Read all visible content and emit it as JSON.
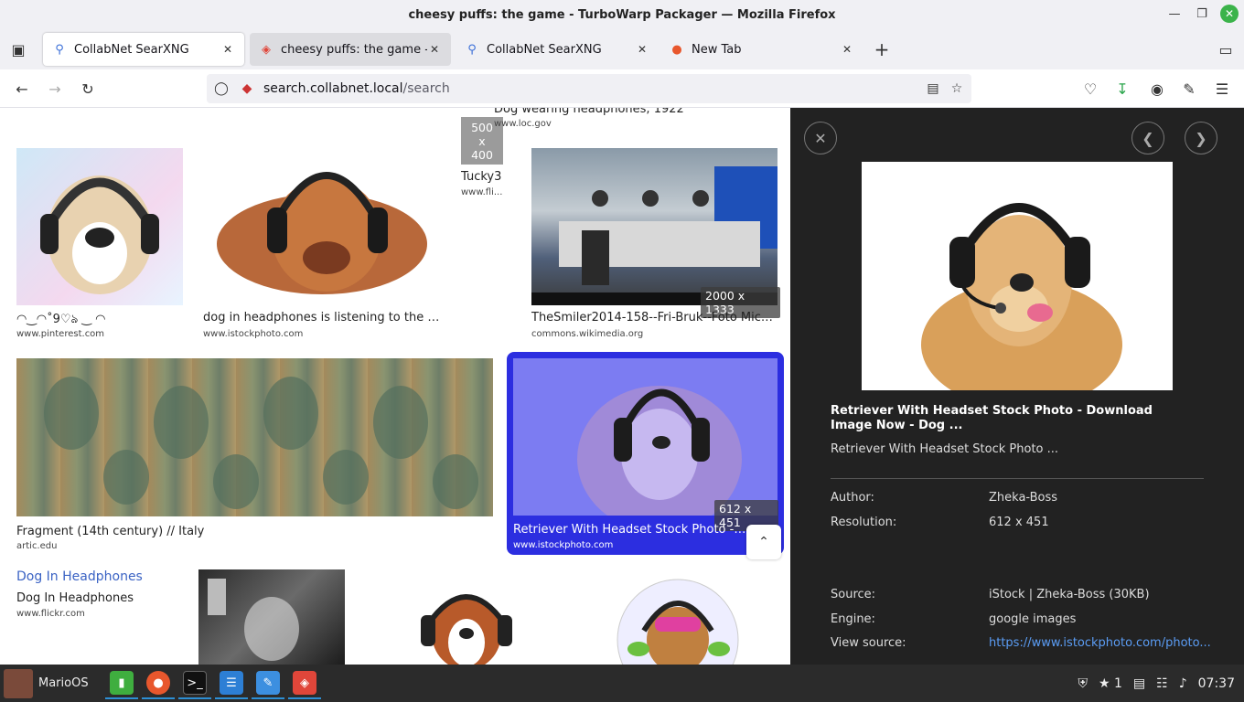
{
  "window": {
    "title": "cheesy puffs: the game - TurboWarp Packager — Mozilla Firefox"
  },
  "tabs": [
    {
      "label": "CollabNet SearXNG",
      "favicon": "search-icon"
    },
    {
      "label": "cheesy puffs: the game - TurboWarp Packager",
      "favicon": "turbowarp-icon"
    },
    {
      "label": "CollabNet SearXNG",
      "favicon": "search-icon"
    },
    {
      "label": "New Tab",
      "favicon": "firefox-icon"
    }
  ],
  "nav": {
    "url_host": "search.collabnet.local",
    "url_path": "/search"
  },
  "results": [
    {
      "title": "Dog wearing headphones, 1922",
      "domain": "www.loc.gov"
    },
    {
      "title": "Tucky3",
      "domain": "www.fli...",
      "size": "500 x 400"
    },
    {
      "title": "◠‿◠˚9♡ঌ ‿ ◠",
      "domain": "www.pinterest.com"
    },
    {
      "title": "dog in headphones is listening to the mu...",
      "domain": "www.istockphoto.com"
    },
    {
      "title": "TheSmiler2014-158--Fri-Bruk--Foto Michael...",
      "domain": "commons.wikimedia.org",
      "size": "2000 x 1333"
    },
    {
      "title": "Fragment (14th century) // Italy",
      "domain": "artic.edu"
    },
    {
      "title": "Retriever With Headset Stock Photo - Download Image Now - Dog ...",
      "domain": "www.istockphoto.com",
      "size": "612 x 451"
    },
    {
      "title": "Dog In Headphones",
      "subtitle": "Dog In Headphones",
      "domain": "www.flickr.com"
    }
  ],
  "detail": {
    "title": "Retriever With Headset Stock Photo - Download Image Now - Dog ...",
    "subtitle": "Retriever With Headset Stock Photo ...",
    "author_label": "Author:",
    "author": "Zheka-Boss",
    "resolution_label": "Resolution:",
    "resolution": "612 x 451",
    "source_label": "Source:",
    "source": "iStock | Zheka-Boss (30KB)",
    "engine_label": "Engine:",
    "engine": "google images",
    "view_source_label": "View source:",
    "view_source": "https://www.istockphoto.com/photo..."
  },
  "taskbar": {
    "start_label": "MarioOS",
    "notifications": "1",
    "clock": "07:37"
  },
  "colors": {
    "accent": "#2c2ee0",
    "panel": "#222222",
    "link": "#5b9df5"
  }
}
